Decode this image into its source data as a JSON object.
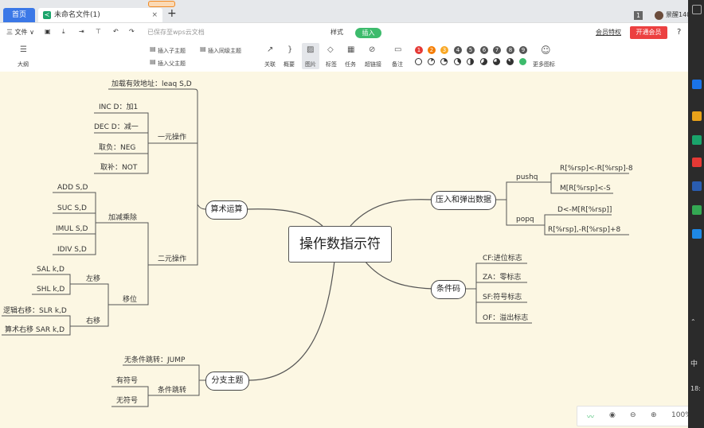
{
  "tabs": {
    "home": "首页",
    "doc": "未命名文件(1)",
    "close": "×",
    "add": "+"
  },
  "window": {
    "badge": "1",
    "user": "景醒140",
    "tab_width": "A"
  },
  "menu": {
    "file": "三 文件 ∨",
    "saved": "已保存至wps云文档",
    "style": "样式",
    "insert": "插入",
    "vip_benefits": "会员特权",
    "open_vip": "开通会员",
    "help": "?"
  },
  "toolbar": {
    "outline": "大纲",
    "insert_child": "插入子主题",
    "insert_parent": "插入父主题",
    "insert_sibling": "插入同级主题",
    "relation": "关联",
    "summary": "概要",
    "image": "图片",
    "tag": "标签",
    "task": "任务",
    "hyperlink": "超链接",
    "note": "备注",
    "more_icons": "更多图标",
    "priorities": [
      "1",
      "2",
      "3",
      "4",
      "5",
      "6",
      "7",
      "8",
      "9"
    ],
    "priority_colors": [
      "#e53935",
      "#f57c00",
      "#f9a825",
      "#555555",
      "#555555",
      "#555555",
      "#555555",
      "#555555",
      "#555555"
    ]
  },
  "mindmap": {
    "center": "操作数指示符",
    "arith": "算术运算",
    "arith_children": {
      "load": "加载有效地址：leaq S,D",
      "unary": "一元操作",
      "inc": "INC D：加1",
      "dec": "DEC D：减一",
      "neg": "取负：NEG",
      "not": "取补：NOT",
      "binary": "二元操作",
      "addmul": "加减乘除",
      "add": "ADD S,D",
      "suc": "SUC S,D",
      "imul": "IMUL S,D",
      "idiv": "IDIV S,D",
      "shift": "移位",
      "left": "左移",
      "sal": "SAL k,D",
      "shl": "SHL k,D",
      "right": "右移",
      "slr": "逻辑右移：SLR k,D",
      "sar": "算术右移 SAR k,D"
    },
    "branch": "分支主题",
    "branch_children": {
      "jump": "无条件跳转：JUMP",
      "cond": "条件跳转",
      "signed": "有符号",
      "unsigned": "无符号"
    },
    "stack": "压入和弹出数据",
    "stack_children": {
      "pushq": "pushq",
      "push1": "R[%rsp]<-R[%rsp]-8",
      "push2": "M[R[%rsp]<-S",
      "popq": "popq",
      "pop1": "D<-M[R[%rsp]]",
      "pop2": "R[%rsp],-R[%rsp]+8"
    },
    "cond_codes": "条件码",
    "cond_children": {
      "cf": "CF:进位标志",
      "za": "ZA：零标志",
      "sf": "SF:符号标志",
      "of": "OF：溢出标志"
    }
  },
  "zoom": {
    "level": "100%"
  },
  "taskbar": {
    "lang": "中",
    "time": "18:"
  }
}
